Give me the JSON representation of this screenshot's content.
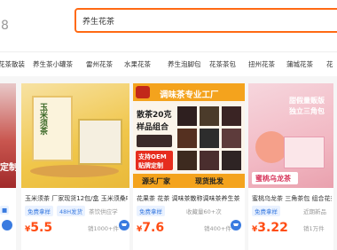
{
  "header": {
    "logo_fragment": "8",
    "search_value": "养生花茶"
  },
  "categories": [
    "花茶散装",
    "养生茶小罐茶",
    "雷州花茶",
    "水果花茶",
    "养生泡脚包",
    "花茶茶包",
    "扭州花茶",
    "蒲城花茶",
    "花"
  ],
  "colors": {
    "accent": "#ff6a14",
    "price": "#ff4d14",
    "link": "#3a7be0"
  },
  "cards": [
    {
      "thumb_text": "定制",
      "title": "",
      "badges": [],
      "price": "",
      "sold": ""
    },
    {
      "thumb_text": "玉米须茶",
      "title": "玉米须茶 厂家现货12包/盒 玉米须桑叶",
      "badges": [
        "免费拿样",
        "48H发货"
      ],
      "meta": "茶饮供应学",
      "price": "5.5",
      "sold": "销1000+件"
    },
    {
      "brand": "调味茶专业工厂",
      "promo_left": "散茶20克",
      "promo_left2": "样品组合",
      "support": "支持OEM",
      "support2": "贴牌定制",
      "footer_left": "源头厂家",
      "footer_right": "现货批发",
      "title": "花果茶 花茶 调味茶散称调味茶养生茶",
      "badges": [
        "免费拿样"
      ],
      "meta": "收藏量60+次",
      "price": "7.6",
      "sold": "销400+件"
    },
    {
      "overlay1": "甜假量贩版",
      "overlay2": "独立三角包",
      "label": "蜜桃乌龙茶",
      "title": "蜜桃乌龙茶 三角茶包 组合花茶包",
      "badges": [
        "免费拿样"
      ],
      "meta": "近期新品",
      "price": "3.22",
      "sold": "销1万件"
    },
    {
      "title": "",
      "badges": [],
      "price": "",
      "sold": ""
    }
  ]
}
